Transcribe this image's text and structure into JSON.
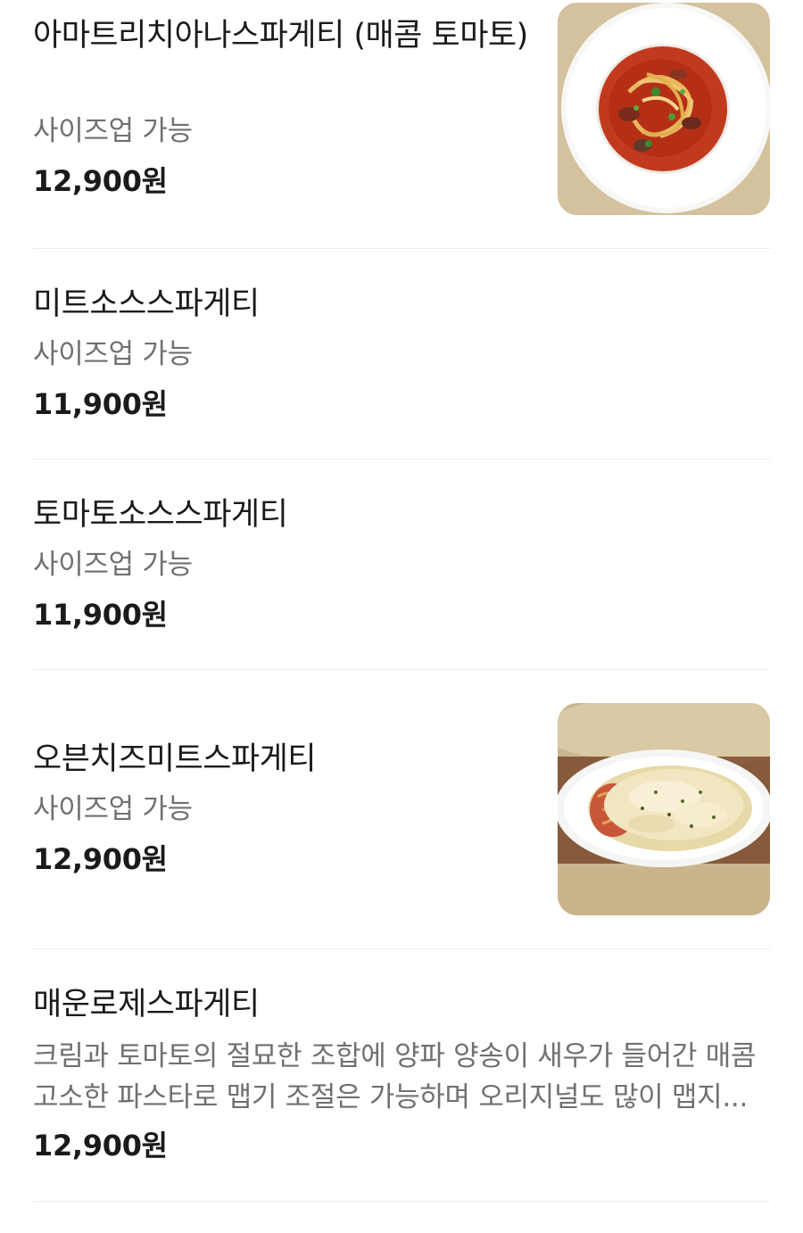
{
  "menu": {
    "items": [
      {
        "name": "아마트리치아나스파게티 (매콤 토마토)",
        "description": "사이즈업 가능",
        "price": "12,900원",
        "image": "amatriciana-pasta-photo"
      },
      {
        "name": "미트소스스파게티",
        "description": "사이즈업 가능",
        "price": "11,900원"
      },
      {
        "name": "토마토소스스파게티",
        "description": "사이즈업 가능",
        "price": "11,900원"
      },
      {
        "name": "오븐치즈미트스파게티",
        "description": "사이즈업 가능",
        "price": "12,900원",
        "image": "oven-cheese-pasta-photo"
      },
      {
        "name": "매운로제스파게티",
        "description": "크림과 토마토의 절묘한 조합에 양파 양송이 새우가 들어간 매콤 고소한 파스타로 맵기 조절은 가능하며 오리지널도 많이 맵지...",
        "price": "12,900원"
      }
    ]
  }
}
